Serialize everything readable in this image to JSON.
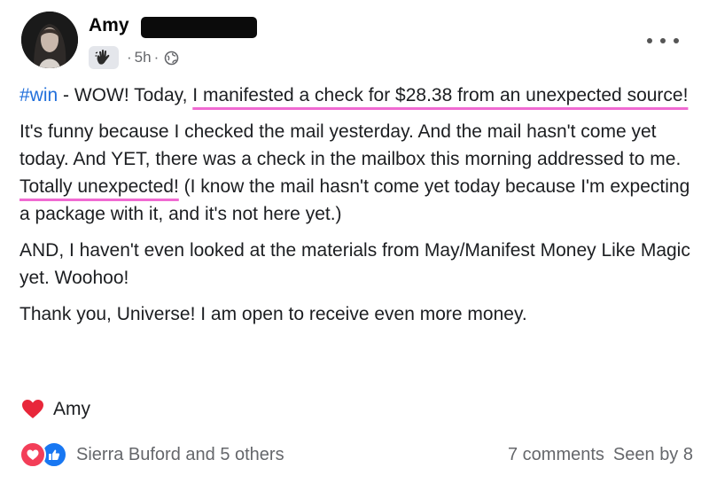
{
  "post": {
    "author": "Amy",
    "time": "5h",
    "meta_sep": "·",
    "text": {
      "hashtag": "#win",
      "p1_a": " - WOW! Today, ",
      "p1_highlight": "I manifested a check for $28.38 from an unexpected source!",
      "p2_a": "It's funny because I checked the mail yesterday. And the mail hasn't come yet today. And YET, there was a check in the mailbox this morning addressed to me. ",
      "p2_highlight": "Totally unexpected!",
      "p2_b": " (I know the mail hasn't come yet today because I'm expecting a package with it, and it's not here yet.)",
      "p3": "AND, I haven't even looked at the materials from May/Manifest Money Like Magic yet. Woohoo!",
      "p4": "Thank you, Universe! I am open to receive even more money."
    },
    "signature": "Amy"
  },
  "footer": {
    "reactors": "Sierra Buford and 5 others",
    "comments": "7 comments",
    "seen": "Seen by 8"
  },
  "icons": {
    "badge": "wave-hand-icon",
    "privacy": "globe-icon",
    "more": "more-options-icon",
    "signature": "heart-icon",
    "reaction_1": "love-reaction-icon",
    "reaction_2": "like-reaction-icon"
  },
  "colors": {
    "hashtag": "#216fdb",
    "underline": "#f06ad2",
    "meta": "#65676b",
    "love": "#f33e58",
    "like": "#1877f2"
  }
}
